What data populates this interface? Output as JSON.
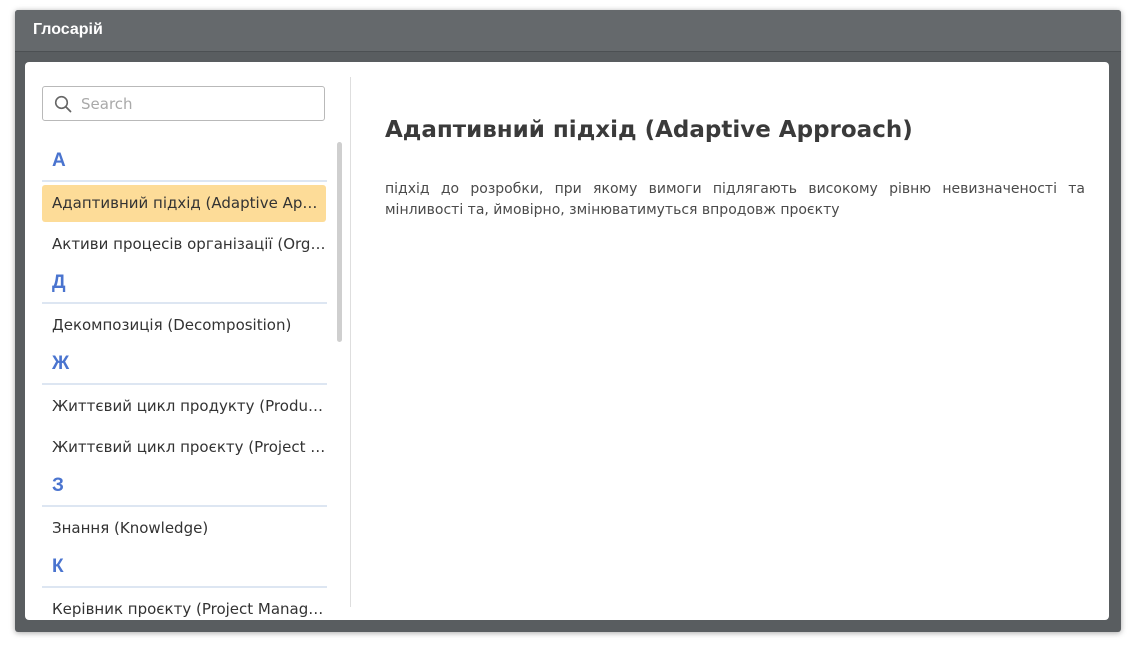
{
  "window": {
    "title": "Глосарій"
  },
  "search": {
    "placeholder": "Search",
    "value": ""
  },
  "glossary": {
    "groups": [
      {
        "letter": "А",
        "items": [
          {
            "label": "Адаптивний підхід (Adaptive Approach)",
            "selected": true
          },
          {
            "label": "Активи процесів організації (Organizational Process Assets)",
            "selected": false
          }
        ]
      },
      {
        "letter": "Д",
        "items": [
          {
            "label": "Декомпозиція (Decomposition)",
            "selected": false
          }
        ]
      },
      {
        "letter": "Ж",
        "items": [
          {
            "label": "Життєвий цикл продукту (Product Life Cycle)",
            "selected": false
          },
          {
            "label": "Життєвий цикл проєкту (Project Life Cycle)",
            "selected": false
          }
        ]
      },
      {
        "letter": "З",
        "items": [
          {
            "label": "Знання (Knowledge)",
            "selected": false
          }
        ]
      },
      {
        "letter": "К",
        "items": [
          {
            "label": "Керівник проєкту (Project Manager)",
            "selected": false
          }
        ]
      }
    ]
  },
  "detail": {
    "title": "Адаптивний підхід (Adaptive Approach)",
    "text": "підхід до розробки, при якому вимоги підлягають високому рівню невизначеності та мінливості та, ймовірно, змінюватимуться впродовж проєкту"
  },
  "colors": {
    "accent": "#4a74cf",
    "selected": "#fddc98",
    "titlebar": "#65696c"
  }
}
